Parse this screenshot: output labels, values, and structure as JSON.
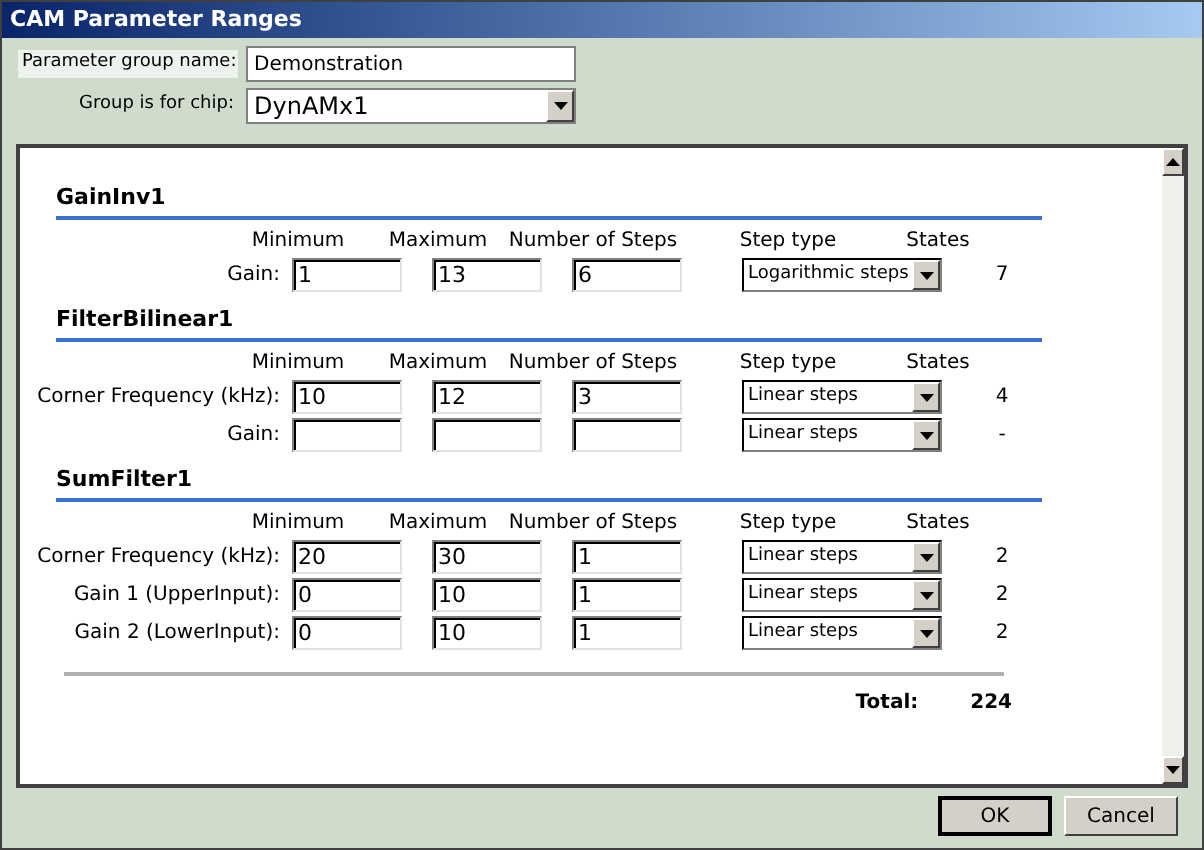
{
  "window": {
    "title": "CAM Parameter Ranges"
  },
  "group_name": {
    "label": "Parameter group name:",
    "value": "Demonstration"
  },
  "chip": {
    "label": "Group is for chip:",
    "value": "DynAMx1"
  },
  "groups": [
    {
      "title": "GainInv1",
      "columns": [
        "Minimum",
        "Maximum",
        "Number of Steps",
        "Step type",
        "States"
      ],
      "rows": [
        {
          "label": "Gain:",
          "minimum": "1",
          "maximum": "13",
          "steps": "6",
          "step_type": "Logarithmic steps",
          "states": "7"
        }
      ]
    },
    {
      "title": "FilterBilinear1",
      "columns": [
        "Minimum",
        "Maximum",
        "Number of Steps",
        "Step type",
        "States"
      ],
      "rows": [
        {
          "label": "Corner Frequency (kHz):",
          "minimum": "10",
          "maximum": "12",
          "steps": "3",
          "step_type": "Linear steps",
          "states": "4"
        },
        {
          "label": "Gain:",
          "step_type": "Linear steps",
          "states": "-"
        }
      ]
    },
    {
      "title": "SumFilter1",
      "columns": [
        "Minimum",
        "Maximum",
        "Number of Steps",
        "Step type",
        "States"
      ],
      "rows": [
        {
          "label": "Corner Frequency (kHz):",
          "minimum": "20",
          "maximum": "30",
          "steps": "1",
          "step_type": "Linear steps",
          "states": "2"
        },
        {
          "label": "Gain 1 (UpperInput):",
          "minimum": "0",
          "maximum": "10",
          "steps": "1",
          "step_type": "Linear steps",
          "states": "2"
        },
        {
          "label": "Gain 2 (LowerInput):",
          "minimum": "0",
          "maximum": "10",
          "steps": "1",
          "step_type": "Linear steps",
          "states": "2"
        }
      ]
    }
  ],
  "total": {
    "label": "Total:",
    "value": "224"
  },
  "buttons": [
    {
      "label": "OK",
      "default": true
    },
    {
      "label": "Cancel",
      "default": false
    }
  ]
}
